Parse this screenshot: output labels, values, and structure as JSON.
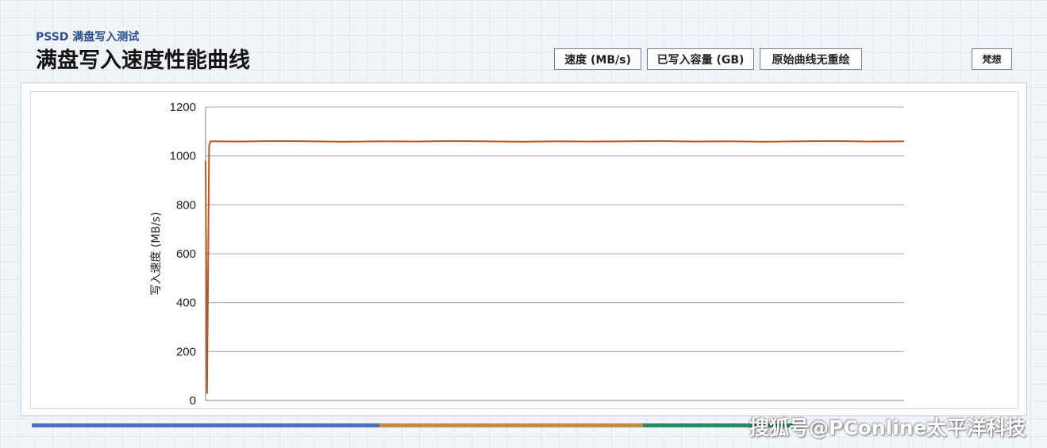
{
  "header": {
    "subtitle": "PSSD 满盘写入测试",
    "title": "满盘写入速度性能曲线"
  },
  "toolbar": {
    "speed_label": "速度 (MB/s)",
    "capacity_label": "已写入容量 (GB)",
    "redraw_label": "原始曲线无重绘",
    "ideas_label": "梵想"
  },
  "watermark": "搜狐号@PConline太平洋科技",
  "colors": {
    "series": "#b5581e",
    "grid": "#a6a6a6",
    "accent_blue": "#4b6fc0",
    "accent_orange": "#c28a45",
    "accent_green": "#2e8a64"
  },
  "chart_data": {
    "type": "line",
    "title": "",
    "xlabel": "",
    "ylabel": "写入速度 (MB/s)",
    "ylim": [
      0,
      1200
    ],
    "yticks": [
      "0",
      "200",
      "400",
      "600",
      "800",
      "1000",
      "1200"
    ],
    "grid": true,
    "legend": "none",
    "x_visible": false,
    "series": [
      {
        "x": [
          0,
          0.2,
          0.35,
          0.5,
          0.7,
          1,
          5,
          10,
          15,
          20,
          25,
          30,
          35,
          40,
          45,
          50,
          55,
          60,
          65,
          70,
          75,
          80,
          85,
          90,
          95,
          100
        ],
        "values": [
          980,
          30,
          500,
          1040,
          1060,
          1060,
          1059,
          1061,
          1060,
          1058,
          1060,
          1059,
          1061,
          1060,
          1058,
          1060,
          1059,
          1060,
          1061,
          1059,
          1060,
          1058,
          1060,
          1061,
          1059,
          1060
        ]
      }
    ]
  }
}
